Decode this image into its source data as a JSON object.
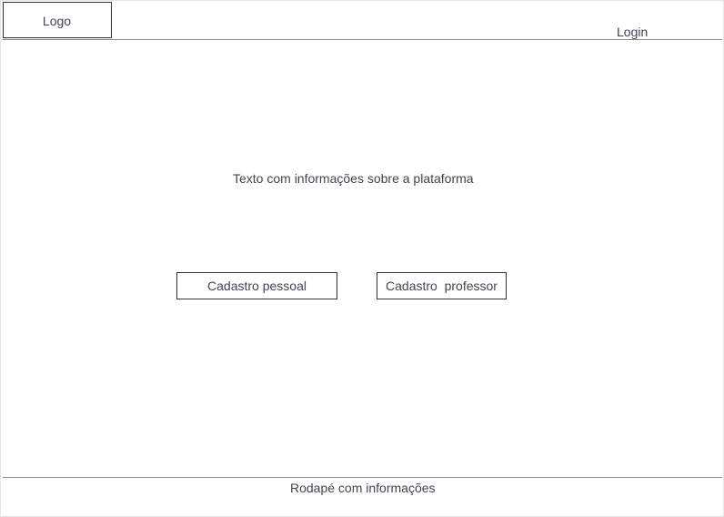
{
  "header": {
    "logo_label": "Logo",
    "login_label": "Login"
  },
  "main": {
    "info_text": "Texto com informações sobre a plataforma",
    "buttons": {
      "cadastro_pessoal": "Cadastro pessoal",
      "cadastro_professor": "Cadastro  professor"
    }
  },
  "footer": {
    "text": "Rodapé com informações"
  },
  "colors": {
    "text": "#3f4652",
    "border": "#333333",
    "divider": "#8a8a8a"
  }
}
